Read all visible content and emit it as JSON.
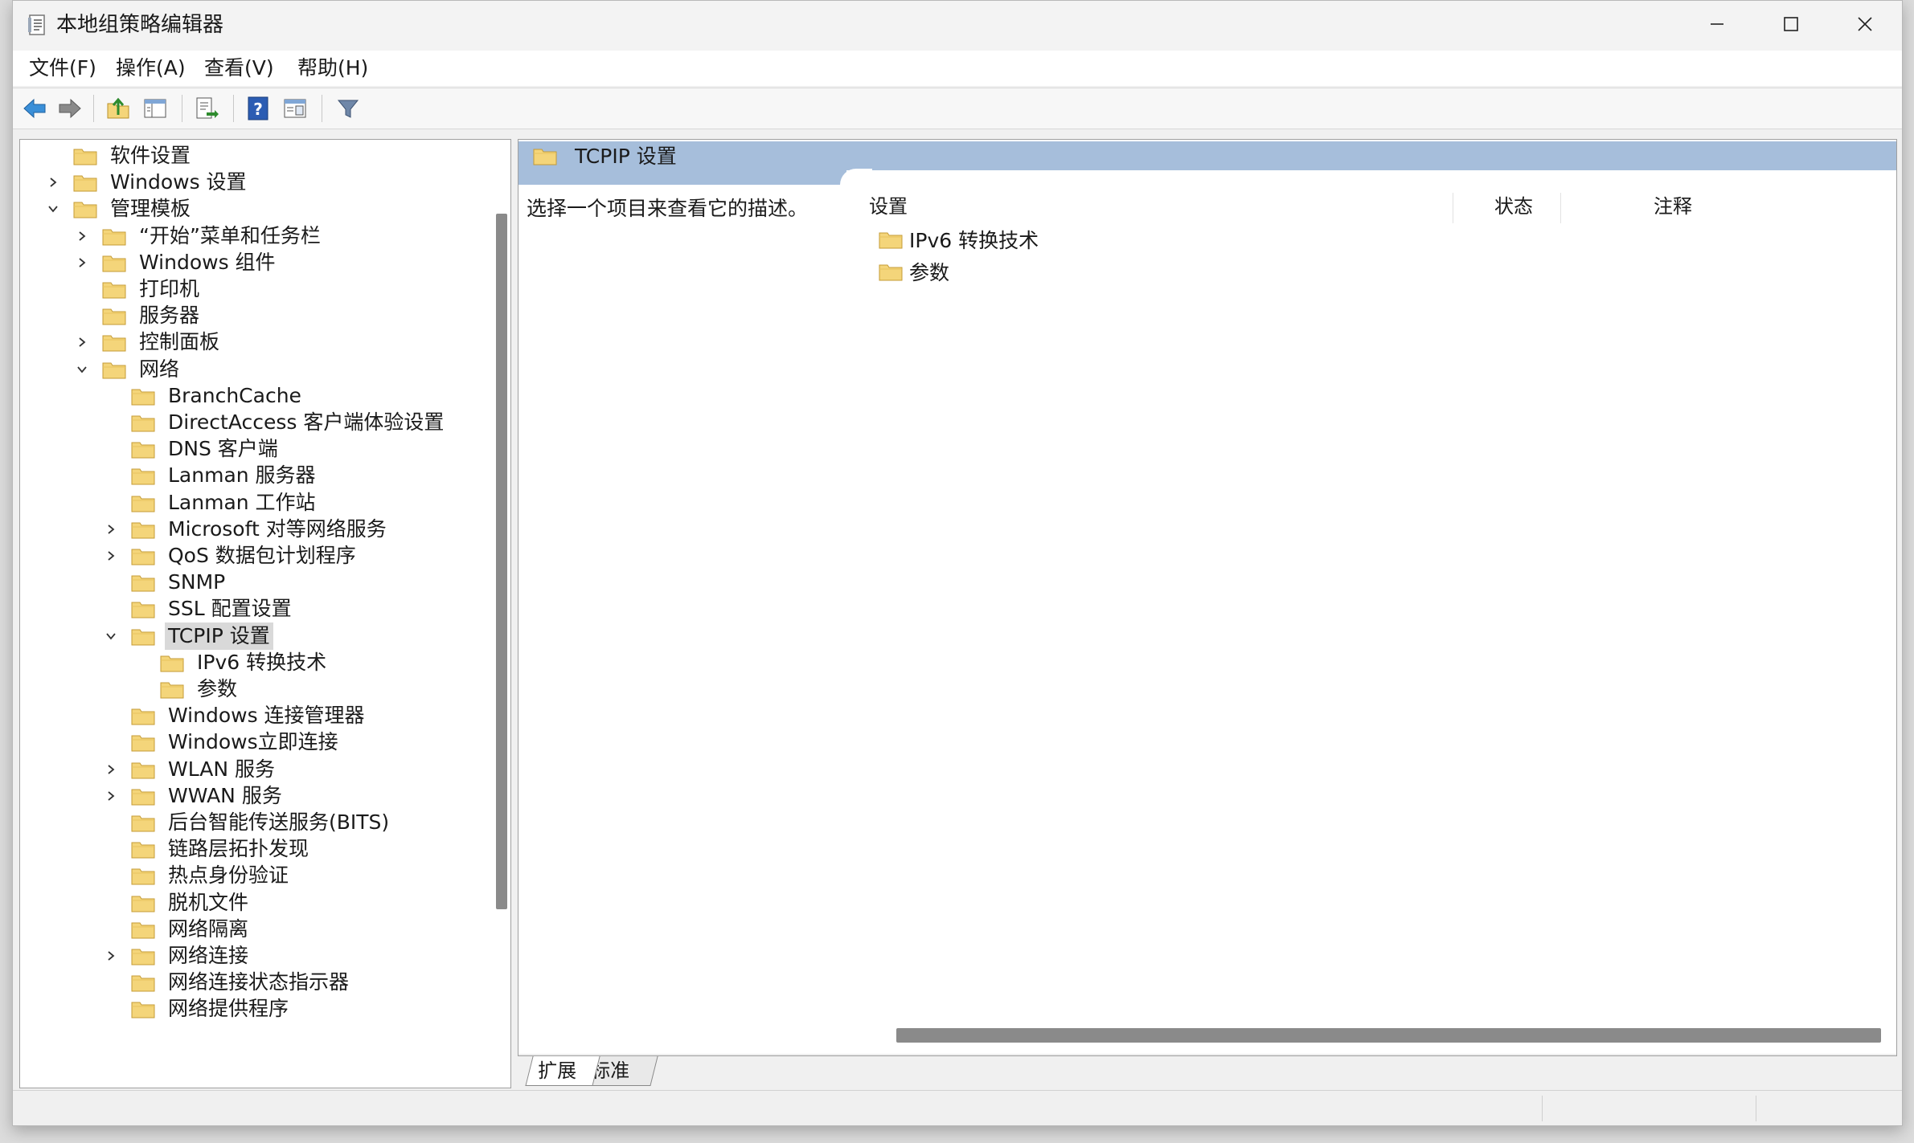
{
  "window": {
    "title": "本地组策略编辑器"
  },
  "menu": {
    "file": "文件(F)",
    "action": "操作(A)",
    "view": "查看(V)",
    "help": "帮助(H)"
  },
  "tree": {
    "items": [
      {
        "label": "软件设置",
        "level": 0,
        "expander": "none"
      },
      {
        "label": "Windows 设置",
        "level": 0,
        "expander": "collapsed"
      },
      {
        "label": "管理模板",
        "level": 0,
        "expander": "expanded"
      },
      {
        "label": "“开始”菜单和任务栏",
        "level": 1,
        "expander": "collapsed"
      },
      {
        "label": "Windows 组件",
        "level": 1,
        "expander": "collapsed"
      },
      {
        "label": "打印机",
        "level": 1,
        "expander": "none"
      },
      {
        "label": "服务器",
        "level": 1,
        "expander": "none"
      },
      {
        "label": "控制面板",
        "level": 1,
        "expander": "collapsed"
      },
      {
        "label": "网络",
        "level": 1,
        "expander": "expanded"
      },
      {
        "label": "BranchCache",
        "level": 2,
        "expander": "none"
      },
      {
        "label": "DirectAccess 客户端体验设置",
        "level": 2,
        "expander": "none"
      },
      {
        "label": "DNS 客户端",
        "level": 2,
        "expander": "none"
      },
      {
        "label": "Lanman 服务器",
        "level": 2,
        "expander": "none"
      },
      {
        "label": "Lanman 工作站",
        "level": 2,
        "expander": "none"
      },
      {
        "label": "Microsoft 对等网络服务",
        "level": 2,
        "expander": "collapsed"
      },
      {
        "label": "QoS 数据包计划程序",
        "level": 2,
        "expander": "collapsed"
      },
      {
        "label": "SNMP",
        "level": 2,
        "expander": "none"
      },
      {
        "label": "SSL 配置设置",
        "level": 2,
        "expander": "none"
      },
      {
        "label": "TCPIP 设置",
        "level": 2,
        "expander": "expanded",
        "selected": true
      },
      {
        "label": "IPv6 转换技术",
        "level": 3,
        "expander": "none"
      },
      {
        "label": "参数",
        "level": 3,
        "expander": "none"
      },
      {
        "label": "Windows 连接管理器",
        "level": 2,
        "expander": "none"
      },
      {
        "label": "Windows立即连接",
        "level": 2,
        "expander": "none"
      },
      {
        "label": "WLAN 服务",
        "level": 2,
        "expander": "collapsed"
      },
      {
        "label": "WWAN 服务",
        "level": 2,
        "expander": "collapsed"
      },
      {
        "label": "后台智能传送服务(BITS)",
        "level": 2,
        "expander": "none"
      },
      {
        "label": "链路层拓扑发现",
        "level": 2,
        "expander": "none"
      },
      {
        "label": "热点身份验证",
        "level": 2,
        "expander": "none"
      },
      {
        "label": "脱机文件",
        "level": 2,
        "expander": "none"
      },
      {
        "label": "网络隔离",
        "level": 2,
        "expander": "none"
      },
      {
        "label": "网络连接",
        "level": 2,
        "expander": "collapsed"
      },
      {
        "label": "网络连接状态指示器",
        "level": 2,
        "expander": "none"
      },
      {
        "label": "网络提供程序",
        "level": 2,
        "expander": "none"
      }
    ]
  },
  "right_pane": {
    "header_title": "TCPIP 设置",
    "description": "选择一个项目来查看它的描述。",
    "columns": {
      "setting": "设置",
      "state": "状态",
      "comment": "注释"
    },
    "items": [
      {
        "label": "IPv6 转换技术"
      },
      {
        "label": "参数"
      }
    ]
  },
  "tabs": {
    "extended": "扩展",
    "standard": "标准"
  },
  "colors": {
    "header_band": "#a6bedb",
    "folder_yellow": "#f4d57a",
    "selection": "#d9d9d9"
  },
  "icons": {
    "toolbar": [
      "back-arrow-icon",
      "forward-arrow-icon",
      "up-folder-icon",
      "show-hide-tree-icon",
      "export-list-icon",
      "help-icon",
      "properties-view-icon",
      "filter-icon"
    ]
  }
}
